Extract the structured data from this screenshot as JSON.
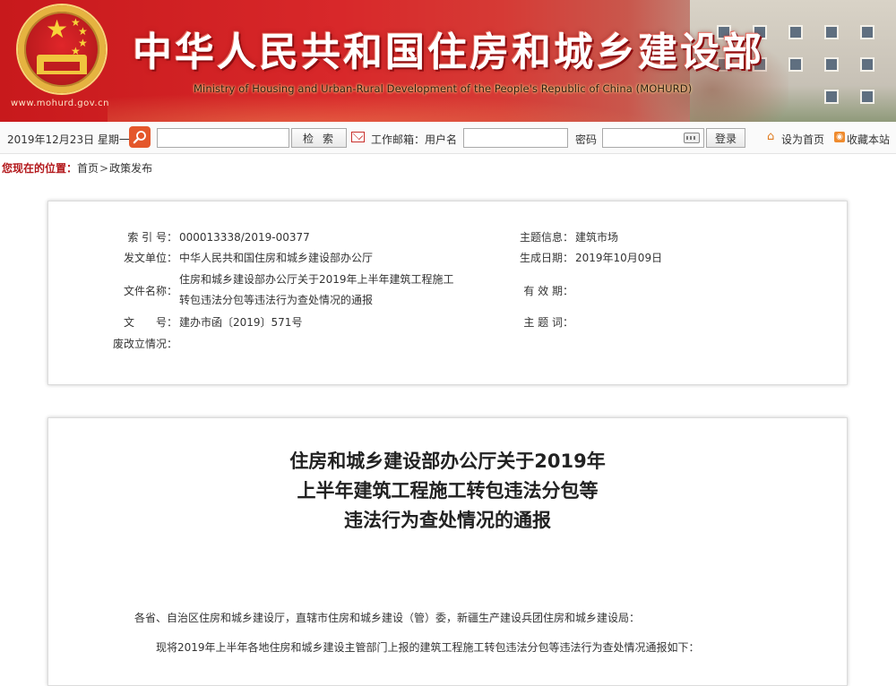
{
  "header": {
    "title_cn": "中华人民共和国住房和城乡建设部",
    "title_en": "Ministry of Housing and Urban-Rural Development of the People's Republic of China (MOHURD)",
    "site_url": "www.mohurd.gov.cn"
  },
  "toolbar": {
    "date": "2019年12月23日  星期一",
    "search_value": "",
    "search_label": "检索",
    "mail_label": "工作邮箱：用户名",
    "username_value": "",
    "password_label": "密码",
    "password_value": "",
    "login_label": "登录",
    "set_home_label": "设为首页",
    "favorite_label": "收藏本站"
  },
  "breadcrumb": {
    "label": "您现在的位置：",
    "items": [
      "首页",
      "政策发布"
    ],
    "separator": ">"
  },
  "info": {
    "index_label": "索 引 号：",
    "index_value": "000013338/2019-00377",
    "topic_label": "主题信息：",
    "topic_value": "建筑市场",
    "issuer_label": "发文单位：",
    "issuer_value": "中华人民共和国住房和城乡建设部办公厅",
    "date_label": "生成日期：",
    "date_value": "2019年10月09日",
    "filename_label": "文件名称：",
    "filename_line1": "住房和城乡建设部办公厅关于2019年上半年建筑工程施工",
    "filename_line2": "转包违法分包等违法行为查处情况的通报",
    "validity_label": "有 效 期：",
    "validity_value": "",
    "docno_label": "文　　号：",
    "docno_value": "建办市函〔2019〕571号",
    "keywords_label": "主 题 词：",
    "keywords_value": "",
    "status_label": "废改立情况：",
    "status_value": ""
  },
  "document": {
    "title_lines": [
      "住房和城乡建设部办公厅关于2019年",
      "上半年建筑工程施工转包违法分包等",
      "违法行为查处情况的通报"
    ],
    "para1": "各省、自治区住房和城乡建设厅，直辖市住房和城乡建设（管）委，新疆生产建设兵团住房和城乡建设局：",
    "para2": "现将2019年上半年各地住房和城乡建设主管部门上报的建筑工程施工转包违法分包等违法行为查处情况通报如下："
  },
  "colors": {
    "brand_red": "#c8191c",
    "crumb_label": "#b3191c",
    "search_icon_bg": "#e4572b"
  }
}
